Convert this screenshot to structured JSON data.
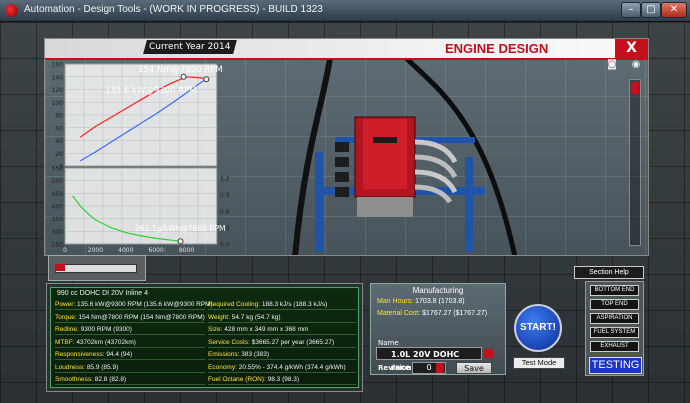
{
  "window": {
    "title": "Automation - Design Tools - (WORK IN PROGRESS) - BUILD 1323",
    "minimize": "–",
    "maximize": "□",
    "close": "✕"
  },
  "header": {
    "current_year": "Current Year 2014",
    "title": "ENGINE DESIGN",
    "close_label": "X"
  },
  "chart_data": [
    {
      "type": "line",
      "x": [
        1000,
        2000,
        3000,
        4000,
        5000,
        6000,
        7000,
        8000,
        9000,
        9300
      ],
      "series": [
        {
          "values": [
            45,
            62,
            76,
            90,
            104,
            118,
            130,
            140,
            138,
            136
          ],
          "color": "#ff2020"
        },
        {
          "values": [
            8,
            22,
            37,
            52,
            67,
            82,
            98,
            115,
            132,
            135.6
          ],
          "color": "#3a6bff"
        }
      ],
      "ylim": [
        0,
        160
      ],
      "yticks": [
        "160",
        "140",
        "120",
        "100",
        "80",
        "60",
        "40",
        "20",
        "0"
      ],
      "annotations": [
        "154 Nm@7800 RPM",
        "135.6 kW@9300 RPM"
      ]
    },
    {
      "type": "line",
      "x": [
        500,
        1000,
        1500,
        2000,
        3000,
        4000,
        5000,
        6000,
        7000,
        7600
      ],
      "series": [
        {
          "values": [
            440,
            400,
            370,
            345,
            315,
            295,
            282,
            272,
            265,
            261.1
          ],
          "color": "#30d030"
        }
      ],
      "ylim": [
        250,
        550
      ],
      "yticks": [
        "550",
        "500",
        "450",
        "400",
        "350",
        "300",
        "250"
      ],
      "y2ticks": [
        "1.2",
        "0.9",
        "0.6",
        "0.3",
        "0.0"
      ],
      "xticks": [
        "0",
        "2000",
        "4000",
        "6000",
        "8000"
      ],
      "annotations": [
        "261.1g/kWh@7600 RPM"
      ]
    }
  ],
  "stats": {
    "engine": "990 cc DOHC DI 20V Inline 4",
    "left": [
      {
        "k": "Power:",
        "v": "135.6 kW@9300 RPM (135.6 kW@9300 RPM)"
      },
      {
        "k": "Torque:",
        "v": "154 Nm@7800 RPM (154 Nm@7800 RPM)"
      },
      {
        "k": "Redline:",
        "v": "9300 RPM (9300)"
      },
      {
        "k": "MTBF:",
        "v": "43702km (43702km)"
      },
      {
        "k": "Responsiveness:",
        "v": "94.4 (94)"
      },
      {
        "k": "Loudness:",
        "v": "85.9 (85.9)"
      },
      {
        "k": "Smoothness:",
        "v": "82.8 (82.8)"
      }
    ],
    "right": [
      {
        "k": "Required Cooling:",
        "v": "188.3 kJ/s (188.3 kJ/s)"
      },
      {
        "k": "Weight:",
        "v": "54.7 kg (54.7 kg)"
      },
      {
        "k": "Size:",
        "v": "428 mm x 349 mm x 368 mm"
      },
      {
        "k": "Service Costs:",
        "v": "$3665.27 per year (3665.27)"
      },
      {
        "k": "Emissions:",
        "v": "383 (383)"
      },
      {
        "k": "Economy:",
        "v": "20.55% - 374.4 g/kWh (374.4 g/kWh)"
      },
      {
        "k": "Fuel Octane (RON):",
        "v": "98.3 (98.3)"
      }
    ]
  },
  "manufacturing": {
    "title": "Manufacturing",
    "man_hours_label": "Man Hours:",
    "man_hours_value": "1703.8 (1703.8)",
    "material_label": "Material Cost:",
    "material_value": "$1767.27 ($1767.27)",
    "name_label": "Name",
    "name_value": "1.0L 20V DOHC race",
    "revision_label": "Revision",
    "revision_value": "0",
    "save_label": "Save"
  },
  "controls": {
    "start_label": "START!",
    "test_mode_label": "Test Mode",
    "section_help_label": "Section Help",
    "testing_label": "TESTING",
    "nav": [
      "BOTTOM END",
      "TOP END",
      "ASPIRATION",
      "FUEL SYSTEM",
      "EXHAUST"
    ]
  },
  "colors": {
    "accent_red": "#c4101c",
    "stat_key": "#ffe12c",
    "torque_curve": "#ff2020",
    "power_curve": "#3a6bff",
    "economy_curve": "#30d030"
  }
}
